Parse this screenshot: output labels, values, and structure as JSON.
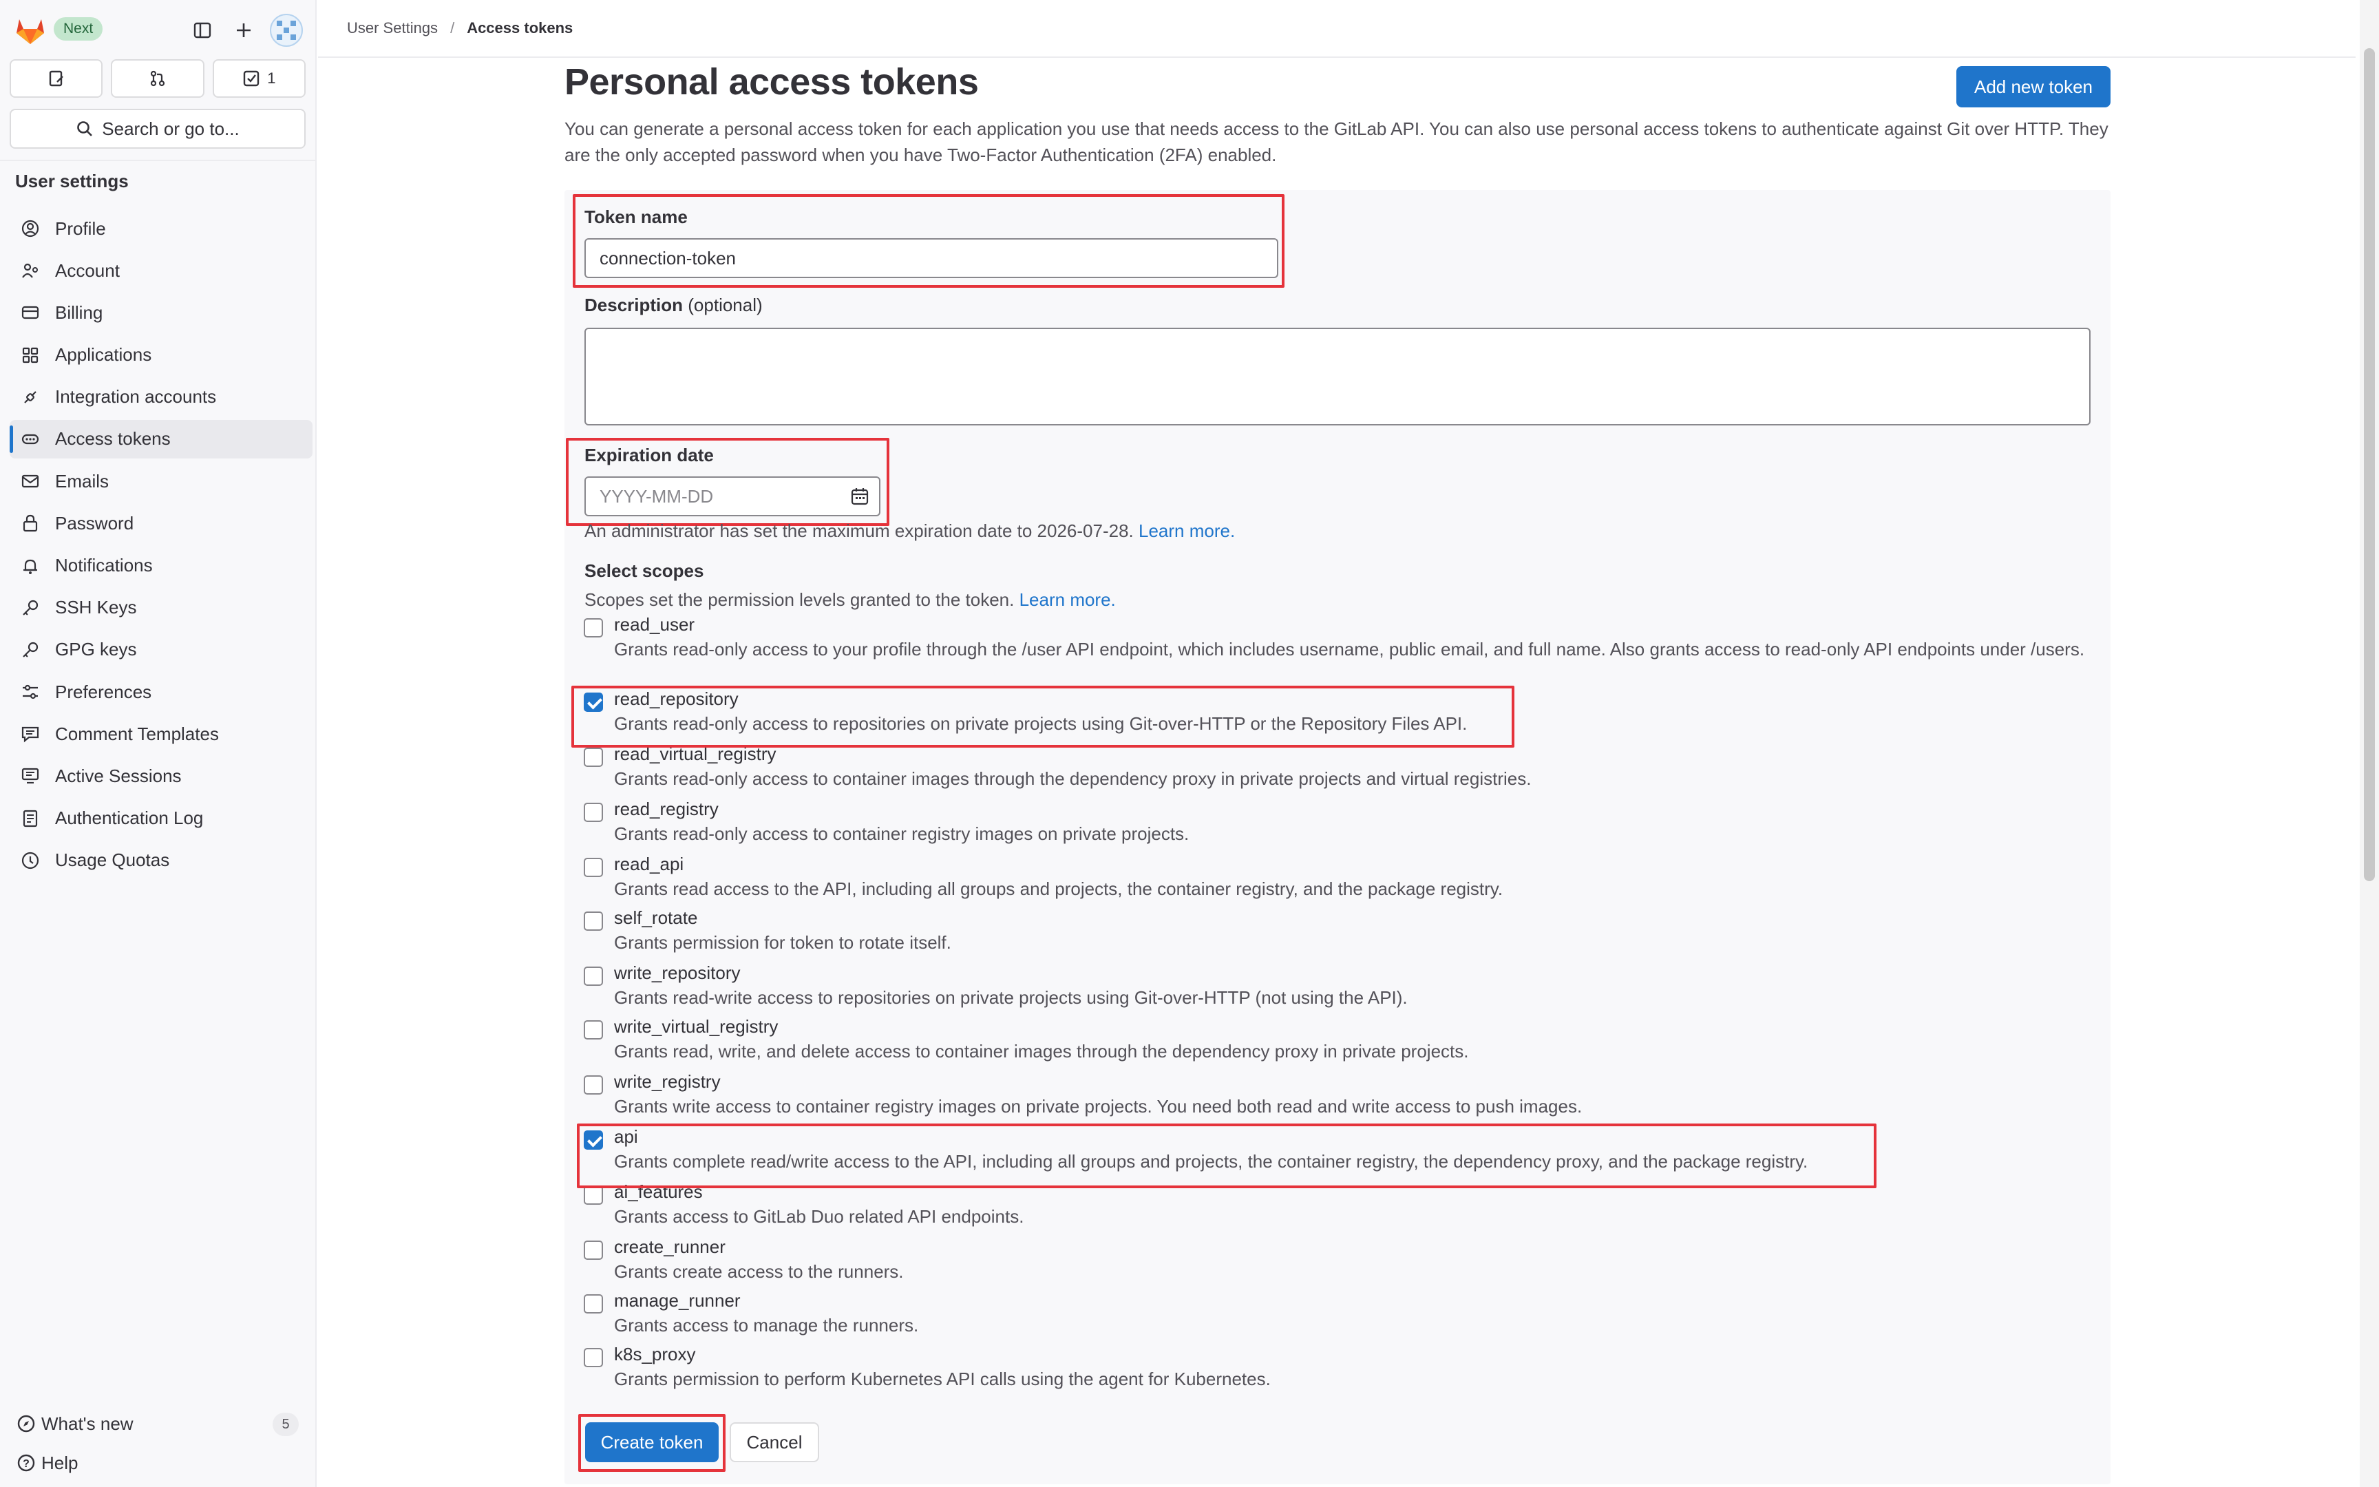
{
  "header": {
    "badge": "Next",
    "todo_count": "1",
    "search_label": "Search or go to..."
  },
  "sidebar": {
    "section_title": "User settings",
    "items": [
      {
        "label": "Profile",
        "icon": "profile-icon"
      },
      {
        "label": "Account",
        "icon": "account-icon"
      },
      {
        "label": "Billing",
        "icon": "billing-icon"
      },
      {
        "label": "Applications",
        "icon": "applications-icon"
      },
      {
        "label": "Integration accounts",
        "icon": "integration-icon"
      },
      {
        "label": "Access tokens",
        "icon": "token-icon",
        "active": true
      },
      {
        "label": "Emails",
        "icon": "mail-icon"
      },
      {
        "label": "Password",
        "icon": "lock-icon"
      },
      {
        "label": "Notifications",
        "icon": "bell-icon"
      },
      {
        "label": "SSH Keys",
        "icon": "key-icon"
      },
      {
        "label": "GPG keys",
        "icon": "key-icon"
      },
      {
        "label": "Preferences",
        "icon": "preferences-icon"
      },
      {
        "label": "Comment Templates",
        "icon": "comment-icon"
      },
      {
        "label": "Active Sessions",
        "icon": "monitor-icon"
      },
      {
        "label": "Authentication Log",
        "icon": "log-icon"
      },
      {
        "label": "Usage Quotas",
        "icon": "quota-icon"
      }
    ],
    "whats_new": "What's new",
    "whats_new_count": "5",
    "help": "Help"
  },
  "breadcrumb": {
    "parent": "User Settings",
    "separator": "/",
    "current": "Access tokens"
  },
  "page": {
    "title": "Personal access tokens",
    "add_button": "Add new token",
    "intro": "You can generate a personal access token for each application you use that needs access to the GitLab API. You can also use personal access tokens to authenticate against Git over HTTP. They are the only accepted password when you have Two-Factor Authentication (2FA) enabled."
  },
  "form": {
    "token_name_label": "Token name",
    "token_name_value": "connection-token",
    "description_label": "Description",
    "description_optional": "(optional)",
    "description_value": "",
    "expiration_label": "Expiration date",
    "expiration_placeholder": "YYYY-MM-DD",
    "expiration_help": "An administrator has set the maximum expiration date to 2026-07-28.",
    "expiration_help_link": "Learn more.",
    "scopes_label": "Select scopes",
    "scopes_help": "Scopes set the permission levels granted to the token.",
    "scopes_help_link": "Learn more.",
    "scopes": [
      {
        "name": "read_user",
        "checked": false,
        "description": "Grants read-only access to your profile through the /user API endpoint, which includes username, public email, and full name. Also grants access to read-only API endpoints under /users."
      },
      {
        "name": "read_repository",
        "checked": true,
        "description": "Grants read-only access to repositories on private projects using Git-over-HTTP or the Repository Files API."
      },
      {
        "name": "read_virtual_registry",
        "checked": false,
        "description": "Grants read-only access to container images through the dependency proxy in private projects and virtual registries."
      },
      {
        "name": "read_registry",
        "checked": false,
        "description": "Grants read-only access to container registry images on private projects."
      },
      {
        "name": "read_api",
        "checked": false,
        "description": "Grants read access to the API, including all groups and projects, the container registry, and the package registry."
      },
      {
        "name": "self_rotate",
        "checked": false,
        "description": "Grants permission for token to rotate itself."
      },
      {
        "name": "write_repository",
        "checked": false,
        "description": "Grants read-write access to repositories on private projects using Git-over-HTTP (not using the API)."
      },
      {
        "name": "write_virtual_registry",
        "checked": false,
        "description": "Grants read, write, and delete access to container images through the dependency proxy in private projects."
      },
      {
        "name": "write_registry",
        "checked": false,
        "description": "Grants write access to container registry images on private projects. You need both read and write access to push images."
      },
      {
        "name": "api",
        "checked": true,
        "description": "Grants complete read/write access to the API, including all groups and projects, the container registry, the dependency proxy, and the package registry."
      },
      {
        "name": "ai_features",
        "checked": false,
        "description": "Grants access to GitLab Duo related API endpoints."
      },
      {
        "name": "create_runner",
        "checked": false,
        "description": "Grants create access to the runners."
      },
      {
        "name": "manage_runner",
        "checked": false,
        "description": "Grants access to manage the runners."
      },
      {
        "name": "k8s_proxy",
        "checked": false,
        "description": "Grants permission to perform Kubernetes API calls using the agent for Kubernetes."
      }
    ],
    "create_button": "Create token",
    "cancel_button": "Cancel"
  },
  "colors": {
    "accent": "#1f75cb",
    "highlight": "#e5333b",
    "badge_bg": "#c3e6cd"
  }
}
